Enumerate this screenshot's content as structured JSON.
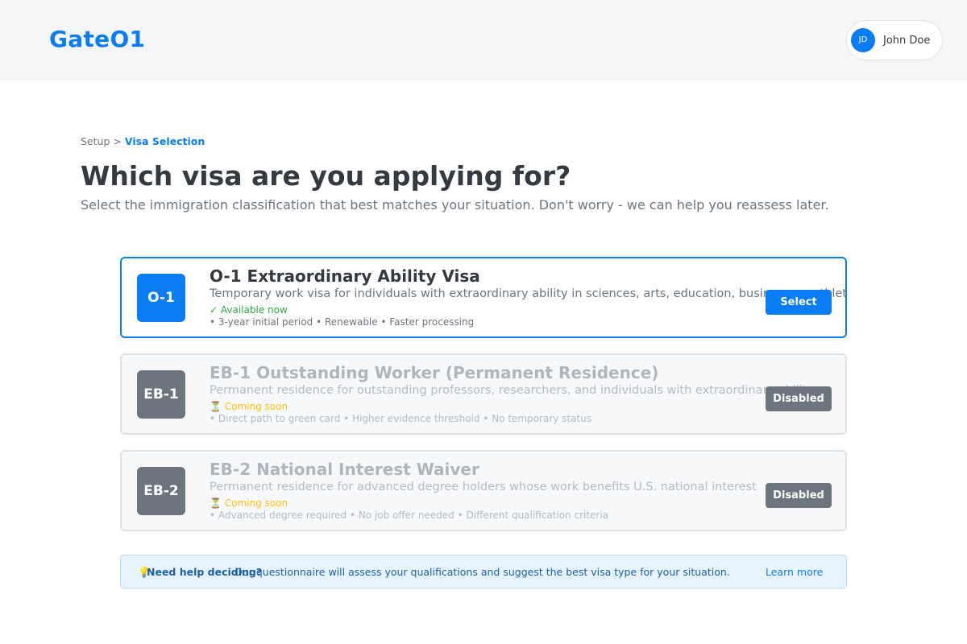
{
  "header": {
    "logo": "GateO1",
    "user": {
      "initials": "JD",
      "name": "John Doe"
    }
  },
  "breadcrumb": {
    "step1": "Setup",
    "separator": ">",
    "current": "Visa Selection"
  },
  "page": {
    "title": "Which visa are you applying for?",
    "subtitle": "Select the immigration classification that best matches your situation. Don't worry - we can help you reassess later."
  },
  "visas": [
    {
      "badge": "O-1",
      "title": "O-1 Extraordinary Ability Visa",
      "description": "Temporary work visa for individuals with extraordinary ability in sciences, arts, education, business, or athletics",
      "status": "✓ Available now",
      "features": "• 3-year initial period • Renewable • Faster processing",
      "button": "Select"
    },
    {
      "badge": "EB-1",
      "title": "EB-1 Outstanding Worker (Permanent Residence)",
      "description": "Permanent residence for outstanding professors, researchers, and individuals with extraordinary ability",
      "status": "⏳ Coming soon",
      "features": "• Direct path to green card • Higher evidence threshold • No temporary status",
      "button": "Disabled"
    },
    {
      "badge": "EB-2",
      "title": "EB-2 National Interest Waiver",
      "description": "Permanent residence for advanced degree holders whose work benefits U.S. national interest",
      "status": "⏳ Coming soon",
      "features": "• Advanced degree required • No job offer needed • Different qualification criteria",
      "button": "Disabled"
    }
  ],
  "help": {
    "icon": "💡",
    "title": "Need help deciding?",
    "text": "Our questionnaire will assess your qualifications and suggest the best visa type for your situation.",
    "link": "Learn more"
  },
  "colors": {
    "accent": "#0a7cf4",
    "success": "#28a745",
    "warning": "#ffc107",
    "muted": "#6c757d"
  }
}
